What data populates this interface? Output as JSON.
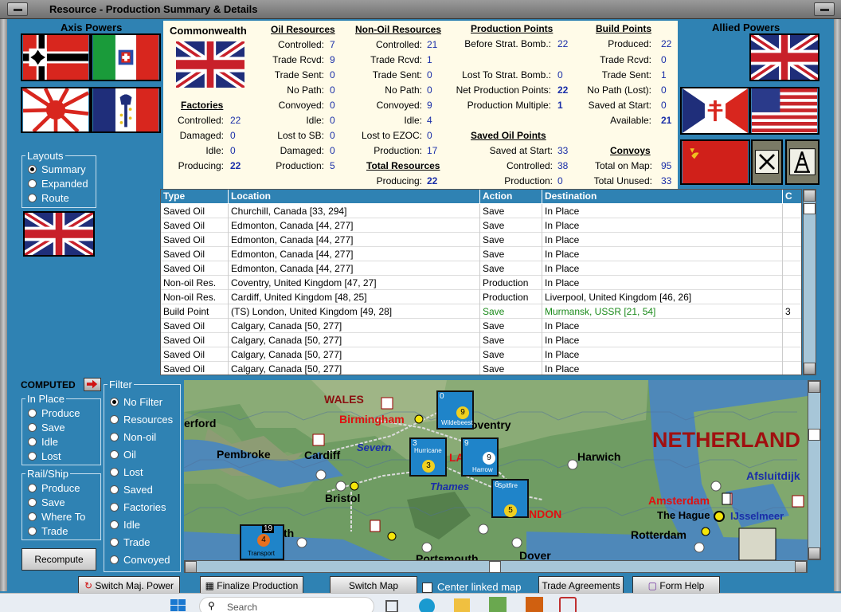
{
  "window": {
    "title": "Resource - Production Summary & Details"
  },
  "axis": {
    "title": "Axis Powers"
  },
  "allied": {
    "title": "Allied Powers"
  },
  "layouts": {
    "title": "Layouts",
    "options": [
      "Summary",
      "Expanded",
      "Route"
    ],
    "selected": "Summary"
  },
  "summary": {
    "nation": "Commonwealth",
    "factories": {
      "title": "Factories",
      "rows": [
        [
          "Controlled:",
          "22"
        ],
        [
          "Damaged:",
          "0"
        ],
        [
          "Idle:",
          "0"
        ],
        [
          "Producing:",
          "22"
        ]
      ]
    },
    "oil": {
      "title": "Oil Resources",
      "rows": [
        [
          "Controlled:",
          "7"
        ],
        [
          "Trade Rcvd:",
          "9"
        ],
        [
          "Trade Sent:",
          "0"
        ],
        [
          "No Path:",
          "0"
        ],
        [
          "Convoyed:",
          "0"
        ],
        [
          "Idle:",
          "0"
        ],
        [
          "Lost to SB:",
          "0"
        ],
        [
          "Damaged:",
          "0"
        ],
        [
          "Production:",
          "5"
        ]
      ]
    },
    "nonoil": {
      "title": "Non-Oil Resources",
      "rows": [
        [
          "Controlled:",
          "21"
        ],
        [
          "Trade Rcvd:",
          "1"
        ],
        [
          "Trade Sent:",
          "0"
        ],
        [
          "No Path:",
          "0"
        ],
        [
          "Convoyed:",
          "9"
        ],
        [
          "Idle:",
          "4"
        ],
        [
          "Lost to EZOC:",
          "0"
        ],
        [
          "Production:",
          "17"
        ]
      ]
    },
    "total": {
      "title": "Total Resources",
      "label": "Producing:",
      "value": "22"
    },
    "pp": {
      "title": "Production Points",
      "rows": [
        [
          "Before Strat. Bomb.:",
          "22"
        ],
        [
          "Lost To Strat. Bomb.:",
          "0"
        ],
        [
          "Net Production Points:",
          "22"
        ],
        [
          "Production Multiple:",
          "1"
        ]
      ]
    },
    "savedoil": {
      "title": "Saved Oil Points",
      "rows": [
        [
          "Saved at Start:",
          "33"
        ],
        [
          "Controlled:",
          "38"
        ],
        [
          "Production:",
          "0"
        ]
      ]
    },
    "bp": {
      "title": "Build Points",
      "rows": [
        [
          "Produced:",
          "22"
        ],
        [
          "Trade Rcvd:",
          "0"
        ],
        [
          "Trade Sent:",
          "1"
        ],
        [
          "No Path (Lost):",
          "0"
        ],
        [
          "Saved at Start:",
          "0"
        ],
        [
          "Available:",
          "21"
        ]
      ]
    },
    "convoys": {
      "title": "Convoys",
      "rows": [
        [
          "Total on Map:",
          "95"
        ],
        [
          "Total Unused:",
          "33"
        ]
      ]
    }
  },
  "table": {
    "headers": [
      "Type",
      "Location",
      "Action",
      "Destination",
      "C"
    ],
    "rows": [
      [
        "Saved Oil",
        "Churchill, Canada [33, 294]",
        "Save",
        "In Place",
        ""
      ],
      [
        "Saved Oil",
        "Edmonton, Canada [44, 277]",
        "Save",
        "In Place",
        ""
      ],
      [
        "Saved Oil",
        "Edmonton, Canada [44, 277]",
        "Save",
        "In Place",
        ""
      ],
      [
        "Saved Oil",
        "Edmonton, Canada [44, 277]",
        "Save",
        "In Place",
        ""
      ],
      [
        "Saved Oil",
        "Edmonton, Canada [44, 277]",
        "Save",
        "In Place",
        ""
      ],
      [
        "Non-oil Res.",
        "Coventry, United Kingdom [47, 27]",
        "Production",
        "In Place",
        ""
      ],
      [
        "Non-oil Res.",
        "Cardiff, United Kingdom [48, 25]",
        "Production",
        "Liverpool, United Kingdom [46, 26]",
        ""
      ],
      [
        "Build Point",
        "(TS) London, United Kingdom [49, 28]",
        "Save",
        "Murmansk, USSR [21, 54]",
        "3"
      ],
      [
        "Saved Oil",
        "Calgary, Canada [50, 277]",
        "Save",
        "In Place",
        ""
      ],
      [
        "Saved Oil",
        "Calgary, Canada [50, 277]",
        "Save",
        "In Place",
        ""
      ],
      [
        "Saved Oil",
        "Calgary, Canada [50, 277]",
        "Save",
        "In Place",
        ""
      ],
      [
        "Saved Oil",
        "Calgary, Canada [50, 277]",
        "Save",
        "In Place",
        ""
      ]
    ]
  },
  "computed": {
    "label": "COMPUTED"
  },
  "inplace": {
    "title": "In Place",
    "options": [
      "Produce",
      "Save",
      "Idle",
      "Lost"
    ]
  },
  "railship": {
    "title": "Rail/Ship",
    "options": [
      "Produce",
      "Save",
      "Where To",
      "Trade"
    ]
  },
  "filter": {
    "title": "Filter",
    "options": [
      "No Filter",
      "Resources",
      "Non-oil",
      "Oil",
      "Lost",
      "Saved",
      "Factories",
      "Idle",
      "Trade",
      "Convoyed"
    ],
    "selected": "No Filter"
  },
  "recompute": "Recompute",
  "map": {
    "labels": {
      "wales": "WALES",
      "birmingham": "Birmingham",
      "coventry": "oventry",
      "netherlands": "NETHERLAND",
      "erford": "erford",
      "pembroke": "Pembroke",
      "cardiff": "Cardiff",
      "severn": "Severn",
      "harwich": "Harwich",
      "afsluitdijk": "Afsluitdijk",
      "thames": "Thames",
      "bristol": "Bristol",
      "london": "NDON",
      "amsterdam": "Amsterdam",
      "thehague": "The Hague",
      "ijsselmeer": "IJsselmeer",
      "rotterdam": "Rotterdam",
      "dover": "Dover",
      "portsmouth": "Portsmouth",
      "la": "LA",
      "pth": "th"
    },
    "units": [
      {
        "top": "0",
        "mid": "9",
        "name": "Wildebeest"
      },
      {
        "top": "3",
        "mid": "3",
        "name": "Hurricane"
      },
      {
        "top": "9",
        "mid": "9",
        "name": "Harrow"
      },
      {
        "top": "6",
        "mid": "5",
        "name": "Spitfire"
      }
    ],
    "transport": {
      "num": "19",
      "val": "4",
      "name": "Transport"
    }
  },
  "buttons": {
    "switch_power": "Switch Maj. Power",
    "finalize": "Finalize Production",
    "switch_map": "Switch Map",
    "center_linked": "Center linked map",
    "trade": "Trade Agreements",
    "help": "Form Help"
  },
  "taskbar": {
    "search": "Search"
  },
  "colors": {
    "bg": "#2f82b3",
    "summary_bg": "#fffbe8",
    "value": "#1a2ea8",
    "city_red": "#e01010",
    "green": "#1a8a1a"
  }
}
